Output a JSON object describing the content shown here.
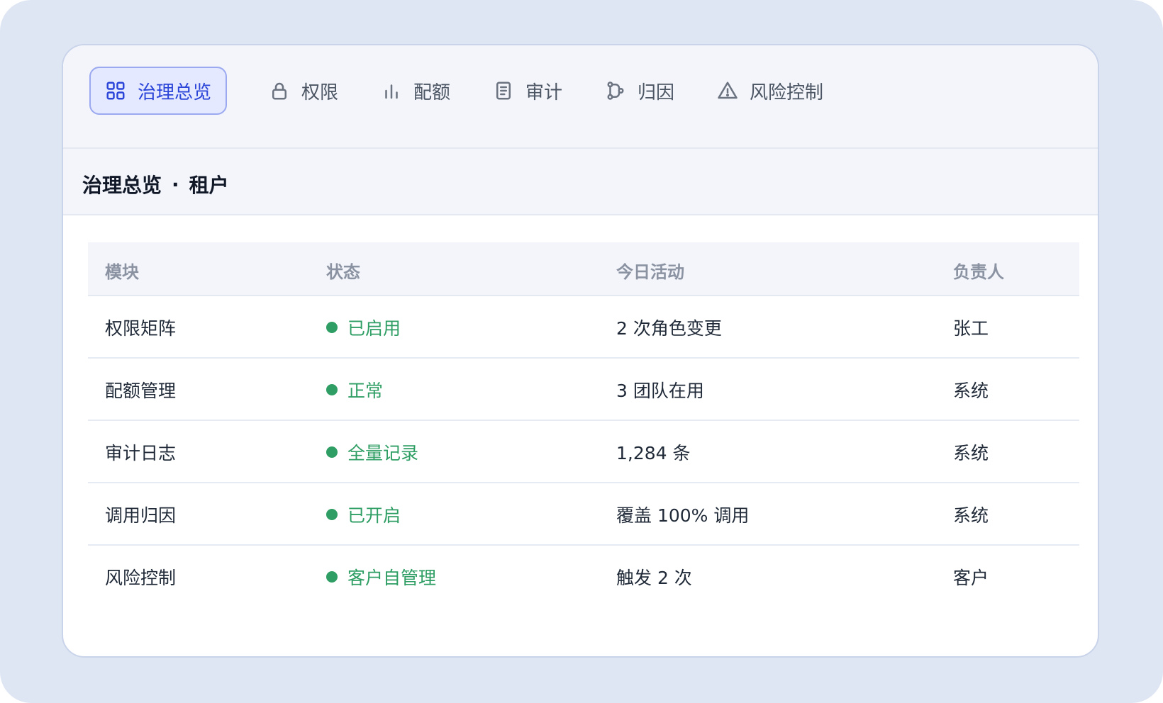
{
  "tabs": [
    {
      "label": "治理总览",
      "icon": "grid-icon",
      "active": true
    },
    {
      "label": "权限",
      "icon": "lock-icon",
      "active": false
    },
    {
      "label": "配额",
      "icon": "bar-chart-icon",
      "active": false
    },
    {
      "label": "审计",
      "icon": "document-icon",
      "active": false
    },
    {
      "label": "归因",
      "icon": "branch-icon",
      "active": false
    },
    {
      "label": "风险控制",
      "icon": "warning-icon",
      "active": false
    }
  ],
  "section": {
    "title": "治理总览",
    "separator": "·",
    "subtitle": "租户"
  },
  "table": {
    "columns": [
      "模块",
      "状态",
      "今日活动",
      "负责人"
    ],
    "rows": [
      {
        "module": "权限矩阵",
        "status": "已启用",
        "activity": "2 次角色变更",
        "owner": "张工"
      },
      {
        "module": "配额管理",
        "status": "正常",
        "activity": "3 团队在用",
        "owner": "系统"
      },
      {
        "module": "审计日志",
        "status": "全量记录",
        "activity": "1,284 条",
        "owner": "系统"
      },
      {
        "module": "调用归因",
        "status": "已开启",
        "activity": "覆盖 100% 调用",
        "owner": "系统"
      },
      {
        "module": "风险控制",
        "status": "客户自管理",
        "activity": "触发 2 次",
        "owner": "客户"
      }
    ]
  },
  "colors": {
    "accent": "#2b45d8",
    "status_ok": "#2f9e64",
    "background": "#dfe6f3"
  }
}
